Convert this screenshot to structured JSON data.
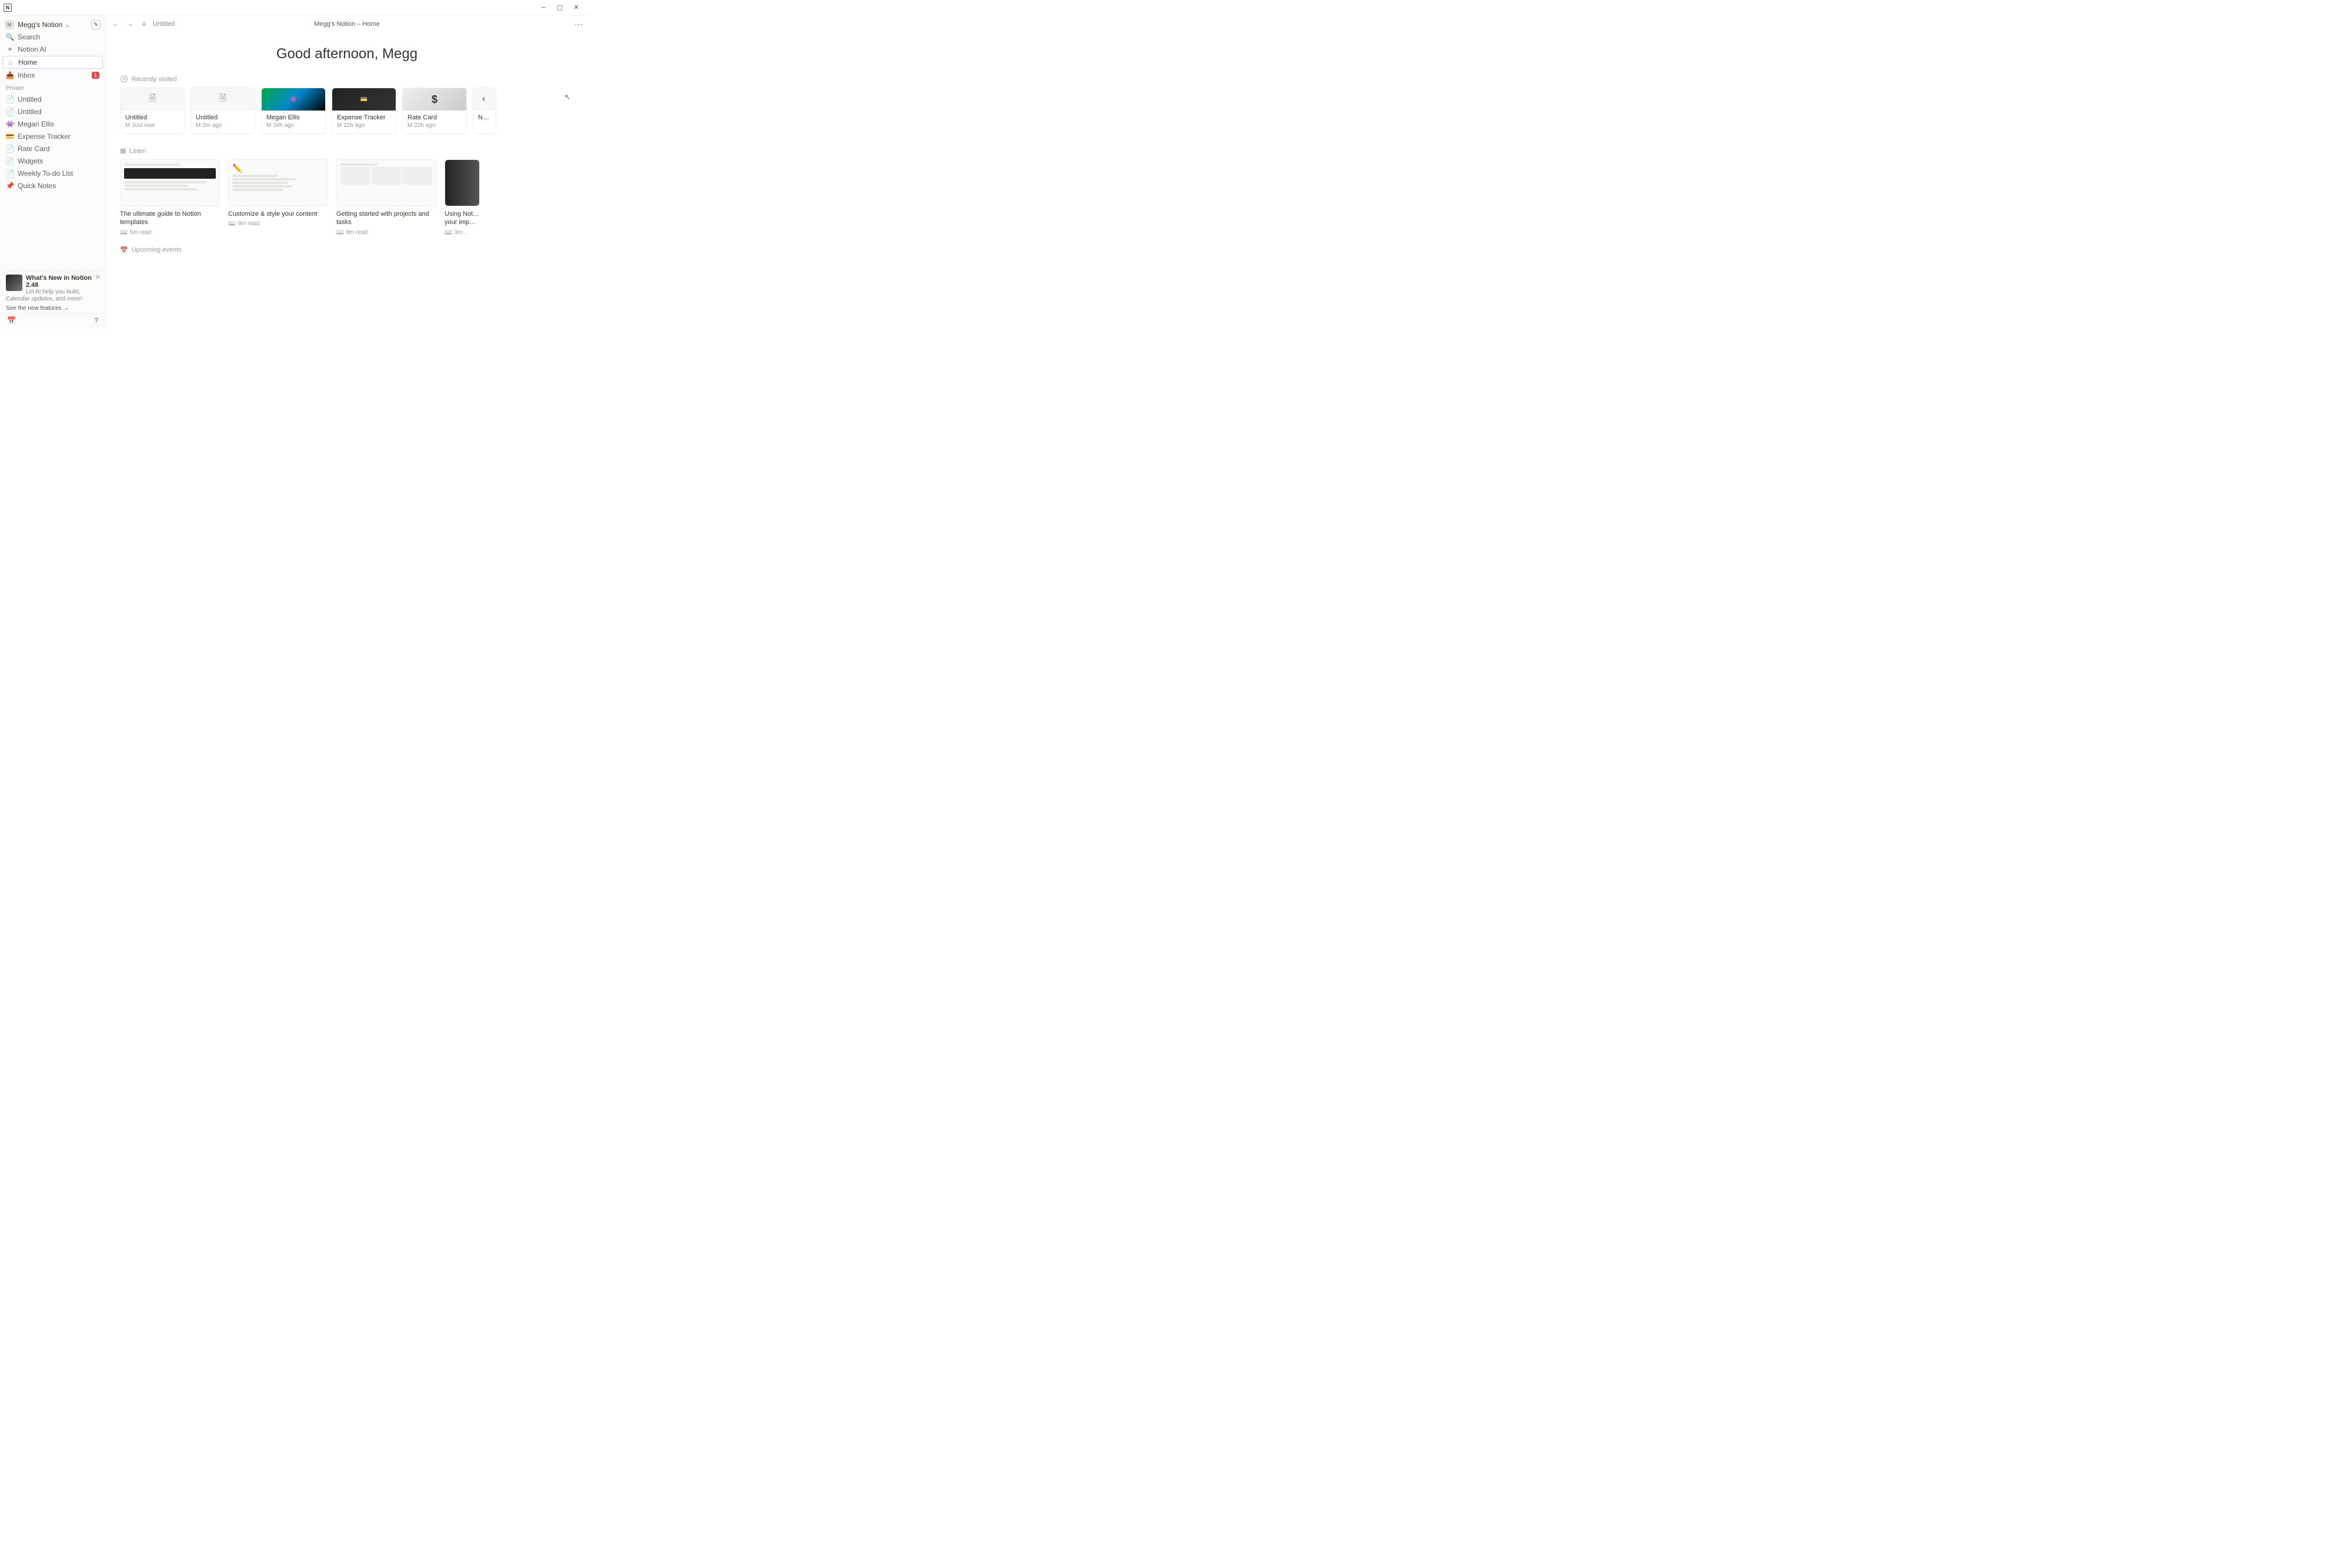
{
  "window_title": "Megg's Notion – Home",
  "breadcrumb": "Untitled",
  "workspace": {
    "avatar": "M",
    "name": "Megg's Notion"
  },
  "sidebar": {
    "search": "Search",
    "ai": "Notion AI",
    "home": "Home",
    "inbox": "Inbox",
    "inbox_badge": "1",
    "private_label": "Private",
    "pages": [
      {
        "icon": "📄",
        "label": "Untitled"
      },
      {
        "icon": "📄",
        "label": "Untitled"
      },
      {
        "icon": "👾",
        "label": "Megan Ellis"
      },
      {
        "icon": "💳",
        "label": "Expense Tracker"
      },
      {
        "icon": "📄",
        "label": "Rate Card"
      },
      {
        "icon": "📄",
        "label": "Widgets"
      },
      {
        "icon": "📄",
        "label": "Weekly To-do List"
      },
      {
        "icon": "📌",
        "label": "Quick Notes"
      }
    ],
    "promo": {
      "title": "What's New in Notion 2.48",
      "sub": "Let AI help you build, Calendar updates, and more!",
      "link": "See the new features  →"
    }
  },
  "greeting": "Good afternoon, Megg",
  "sections": {
    "recent_label": "Recently visited",
    "learn_label": "Learn",
    "upcoming_label": "Upcoming events"
  },
  "recent": [
    {
      "title": "Untitled",
      "meta": "M  Just now",
      "thumb": "doc"
    },
    {
      "title": "Untitled",
      "meta": "M  2m ago",
      "thumb": "doc"
    },
    {
      "title": "Megan Ellis",
      "meta": "M  19h ago",
      "thumb": "img1"
    },
    {
      "title": "Expense Tracker",
      "meta": "M  22h ago",
      "thumb": "img2"
    },
    {
      "title": "Rate Card",
      "meta": "M  22h ago",
      "thumb": "img3",
      "emoji": "$"
    },
    {
      "title": "New…",
      "meta": "",
      "thumb": "blank"
    }
  ],
  "learn": [
    {
      "title": "The ultimate guide to Notion templates",
      "meta": "5m read"
    },
    {
      "title": "Customize & style your content",
      "meta": "9m read"
    },
    {
      "title": "Getting started with projects and tasks",
      "meta": "8m read"
    },
    {
      "title": "Using Not… your imp…",
      "meta": "3m…"
    }
  ]
}
